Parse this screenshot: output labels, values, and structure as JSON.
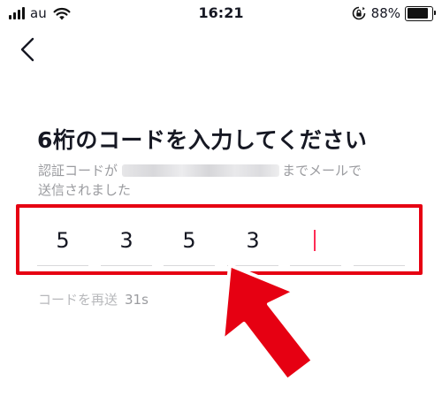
{
  "status_bar": {
    "carrier": "au",
    "time": "16:21",
    "battery_percent": "88%",
    "battery_level": 0.88
  },
  "icons": {
    "back": "chevron-left-icon",
    "wifi": "wifi-icon",
    "rotation_lock": "rotation-lock-icon",
    "battery": "battery-icon"
  },
  "title": "6桁のコードを入力してください",
  "subtitle": {
    "before_email": "認証コードが",
    "after_email": "までメールで",
    "line2": "送信されました"
  },
  "code_digits": [
    "5",
    "3",
    "5",
    "3",
    "",
    ""
  ],
  "resend": {
    "label": "コードを再送",
    "countdown": "31s"
  },
  "colors": {
    "annotation_red": "#e60012",
    "cursor": "#fe2c55",
    "muted_text": "#9a9b9f"
  }
}
